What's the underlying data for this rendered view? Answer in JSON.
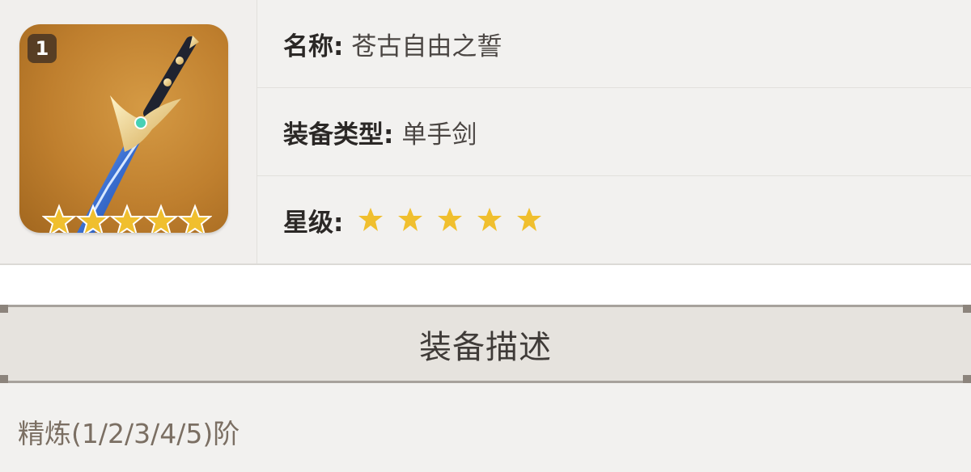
{
  "weapon": {
    "refine_badge": "1",
    "icon": "sword-icon",
    "card_star_count": 5
  },
  "info": {
    "name_label": "名称:",
    "name_value": "苍古自由之誓",
    "type_label": "装备类型:",
    "type_value": "单手剑",
    "rarity_label": "星级:",
    "rarity_stars": 5
  },
  "section": {
    "title": "装备描述"
  },
  "description": {
    "text": "精炼(1/2/3/4/5)阶"
  },
  "colors": {
    "star": "#f0bf2e",
    "card_bg": "#c4852f",
    "header_bg": "#e6e3de"
  }
}
